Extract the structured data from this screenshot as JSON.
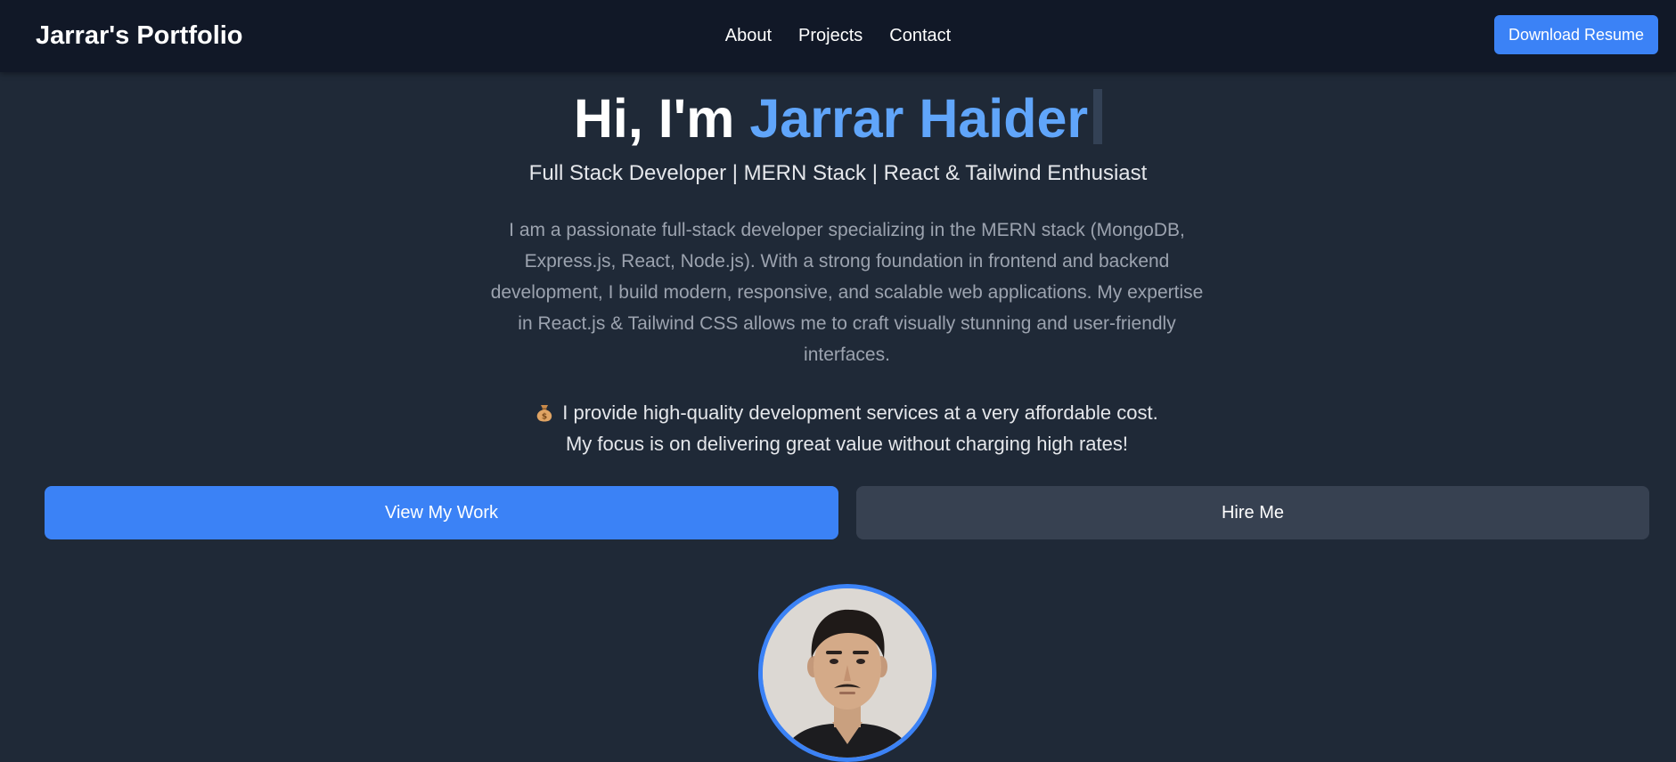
{
  "header": {
    "brand": "Jarrar's Portfolio",
    "nav": [
      {
        "label": "About"
      },
      {
        "label": "Projects"
      },
      {
        "label": "Contact"
      }
    ],
    "resume_button": "Download Resume"
  },
  "hero": {
    "greeting": "Hi, I'm ",
    "name": "Jarrar Haider",
    "subtitle": "Full Stack Developer | MERN Stack | React & Tailwind Enthusiast",
    "intro": "I am a passionate full-stack developer specializing in the MERN stack (MongoDB, Express.js, React, Node.js). With a strong foundation in frontend and backend development, I build modern, responsive, and scalable web applications. My expertise in React.js & Tailwind CSS allows me to craft visually stunning and user-friendly interfaces.",
    "offer_icon": "moneybag-icon",
    "offer": "I provide high-quality development services at a very affordable cost. My focus is on delivering great value without charging high rates!",
    "primary_button": "View My Work",
    "secondary_button": "Hire Me"
  },
  "colors": {
    "accent": "#3b82f6",
    "name_highlight": "#60a5fa",
    "background": "#1f2937",
    "navbar": "#111827",
    "secondary_button": "#374151"
  }
}
